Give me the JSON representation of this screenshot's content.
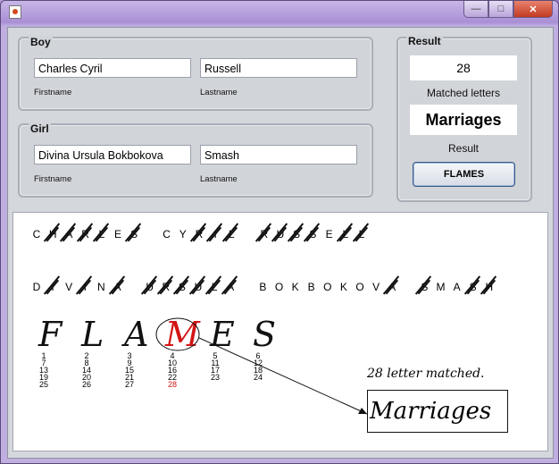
{
  "boy": {
    "title": "Boy",
    "firstname": "Charles Cyril",
    "lastname": "Russell",
    "firstname_label": "Firstname",
    "lastname_label": "Lastname"
  },
  "girl": {
    "title": "Girl",
    "firstname": "Divina Ursula Bokbokova",
    "lastname": "Smash",
    "firstname_label": "Firstname",
    "lastname_label": "Lastname"
  },
  "result": {
    "title": "Result",
    "matched_count": "28",
    "matched_label": "Matched letters",
    "result_value": "Marriages",
    "result_label": "Result",
    "button": "FLAMES"
  },
  "canvas": {
    "boy_letters": [
      "C",
      "H",
      "A",
      "R",
      "L",
      "E",
      "S",
      "",
      "C",
      "Y",
      "R",
      "I",
      "L",
      "",
      "R",
      "U",
      "S",
      "S",
      "E",
      "L",
      "L"
    ],
    "boy_struck": [
      0,
      1,
      1,
      1,
      1,
      0,
      1,
      0,
      0,
      0,
      1,
      1,
      1,
      0,
      1,
      1,
      1,
      1,
      0,
      1,
      1
    ],
    "girl_letters": [
      "D",
      "I",
      "V",
      "I",
      "N",
      "A",
      "",
      "U",
      "R",
      "S",
      "U",
      "L",
      "A",
      "",
      "B",
      "O",
      "K",
      "B",
      "O",
      "K",
      "O",
      "V",
      "A",
      "",
      "S",
      "M",
      "A",
      "S",
      "H"
    ],
    "girl_struck": [
      0,
      1,
      0,
      1,
      0,
      1,
      0,
      1,
      1,
      1,
      1,
      1,
      1,
      0,
      0,
      0,
      0,
      0,
      0,
      0,
      0,
      0,
      1,
      0,
      1,
      0,
      0,
      1,
      1
    ],
    "flames": [
      "F",
      "L",
      "A",
      "M",
      "E",
      "S"
    ],
    "highlight_index": 3,
    "numbers": [
      [
        "1",
        "7",
        "13",
        "19",
        "25"
      ],
      [
        "2",
        "8",
        "14",
        "20",
        "26"
      ],
      [
        "3",
        "9",
        "15",
        "21",
        "27"
      ],
      [
        "4",
        "10",
        "16",
        "22",
        "28"
      ],
      [
        "5",
        "11",
        "17",
        "23"
      ],
      [
        "6",
        "12",
        "18",
        "24"
      ]
    ],
    "highlight_number": "28",
    "matched_text": "28 letter matched.",
    "result_text": "Marriages",
    "highlight_color": "#d31515"
  }
}
